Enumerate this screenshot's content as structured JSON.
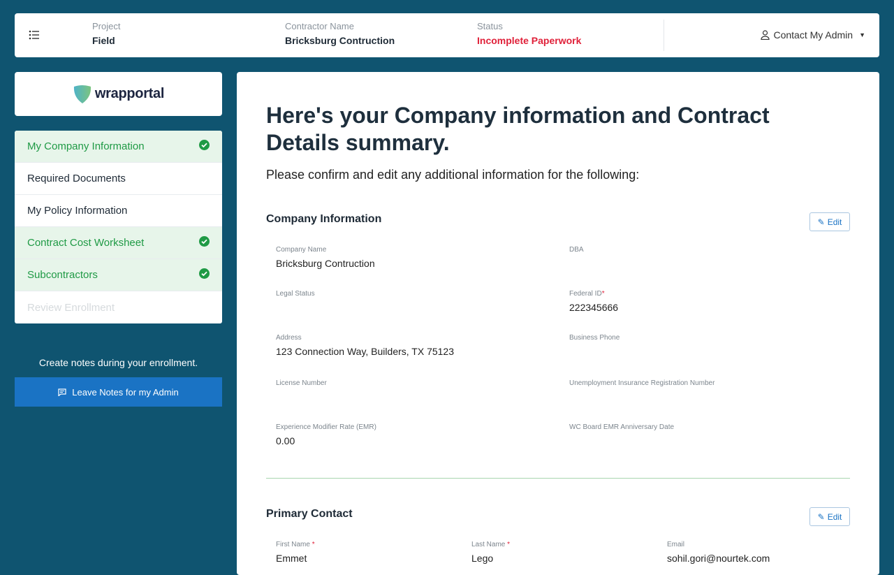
{
  "header": {
    "project_label": "Project",
    "project_value": "Field",
    "contractor_label": "Contractor Name",
    "contractor_value": "Bricksburg Contruction",
    "status_label": "Status",
    "status_value": "Incomplete Paperwork",
    "status_color": "#e0213a",
    "contact_admin": "Contact My Admin"
  },
  "logo": {
    "text": "wrapportal"
  },
  "sidebar": {
    "items": [
      {
        "label": "My Company Information",
        "done": true
      },
      {
        "label": "Required Documents",
        "done": false
      },
      {
        "label": "My Policy Information",
        "done": false
      },
      {
        "label": "Contract Cost Worksheet",
        "done": true
      },
      {
        "label": "Subcontractors",
        "done": true
      },
      {
        "label": "Review Enrollment",
        "done": false,
        "disabled": true
      }
    ],
    "notes_text": "Create notes during your enrollment.",
    "notes_button": "Leave Notes for my Admin"
  },
  "main": {
    "title": "Here's your Company information and Contract Details summary.",
    "subtitle": "Please confirm and edit any additional information for the following:",
    "edit_label": "Edit",
    "company": {
      "title": "Company Information",
      "fields": [
        {
          "label": "Company Name",
          "value": "Bricksburg Contruction"
        },
        {
          "label": "DBA",
          "value": ""
        },
        {
          "label": "Legal Status",
          "value": ""
        },
        {
          "label": "Federal ID",
          "value": "222345666",
          "required": "*"
        },
        {
          "label": "Address",
          "value": "123 Connection Way, Builders, TX 75123"
        },
        {
          "label": "Business Phone",
          "value": ""
        },
        {
          "label": "License Number",
          "value": ""
        },
        {
          "label": "Unemployment Insurance Registration Number",
          "value": ""
        },
        {
          "label": "Experience Modifier Rate (EMR)",
          "value": "0.00"
        },
        {
          "label": "WC Board EMR Anniversary Date",
          "value": ""
        }
      ]
    },
    "contact": {
      "title": "Primary Contact",
      "fields": [
        {
          "label": "First Name",
          "value": "Emmet",
          "required": "*"
        },
        {
          "label": "Last Name",
          "value": "Lego",
          "required": "*"
        },
        {
          "label": "Email",
          "value": "sohil.gori@nourtek.com"
        }
      ]
    }
  }
}
